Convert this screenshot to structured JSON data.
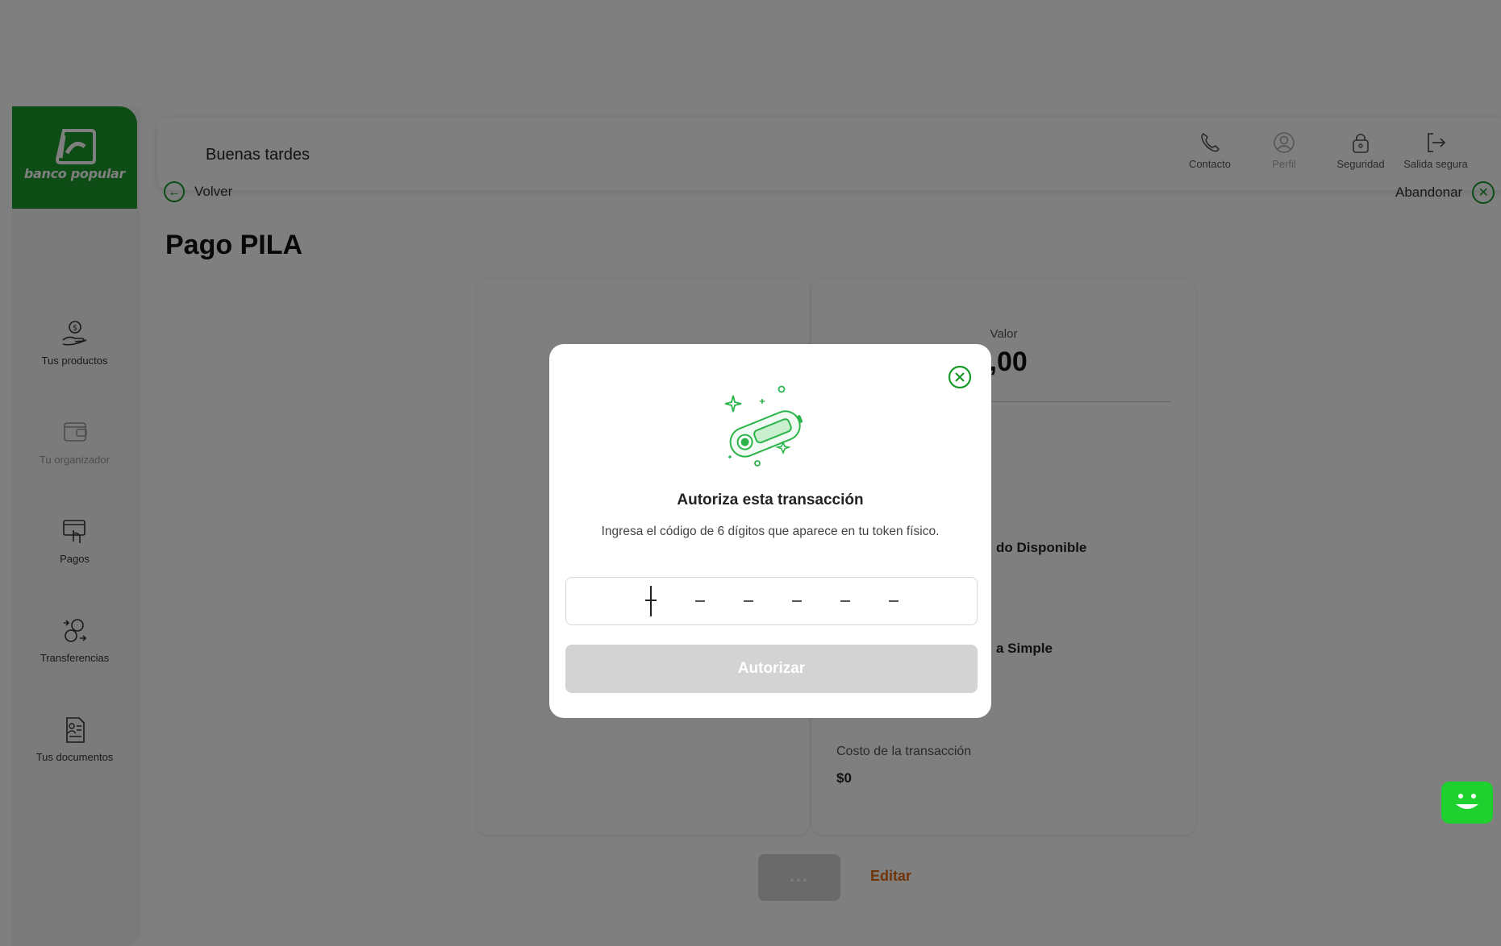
{
  "brand": {
    "name": "banco popular",
    "color": "#1a9a2b"
  },
  "header": {
    "greeting": "Buenas tardes",
    "actions": [
      {
        "label": "Contacto",
        "icon": "phone-icon"
      },
      {
        "label": "Perfil",
        "icon": "user-icon"
      },
      {
        "label": "Seguridad",
        "icon": "lock-icon"
      },
      {
        "label": "Salida segura",
        "icon": "logout-icon"
      }
    ]
  },
  "sidebar": {
    "items": [
      {
        "label": "Tus productos",
        "icon": "hand-coin-icon"
      },
      {
        "label": "Tu organizador",
        "icon": "wallet-icon"
      },
      {
        "label": "Pagos",
        "icon": "payments-icon"
      },
      {
        "label": "Transferencias",
        "icon": "transfer-icon"
      },
      {
        "label": "Tus documentos",
        "icon": "document-icon"
      }
    ]
  },
  "nav": {
    "back": "Volver",
    "abandon": "Abandonar"
  },
  "page": {
    "title": "Pago PILA"
  },
  "summary": {
    "value_label": "Valor",
    "value_amount": "),00",
    "row1": "do Disponible",
    "row2": "a Simple",
    "cost_label": "Costo de la transacción",
    "cost_value": "$0"
  },
  "footer": {
    "continue": "...",
    "edit": "Editar"
  },
  "modal": {
    "title": "Autoriza esta transacción",
    "subtitle": "Ingresa el código de 6 dígitos que aparece en tu token físico.",
    "code_placeholder": "- - - - - -",
    "authorize": "Autorizar"
  },
  "colors": {
    "accent": "#1a9a2b",
    "edit": "#e06a10",
    "disabled_button": "#d3d3d3",
    "chat": "#1fd12e"
  }
}
